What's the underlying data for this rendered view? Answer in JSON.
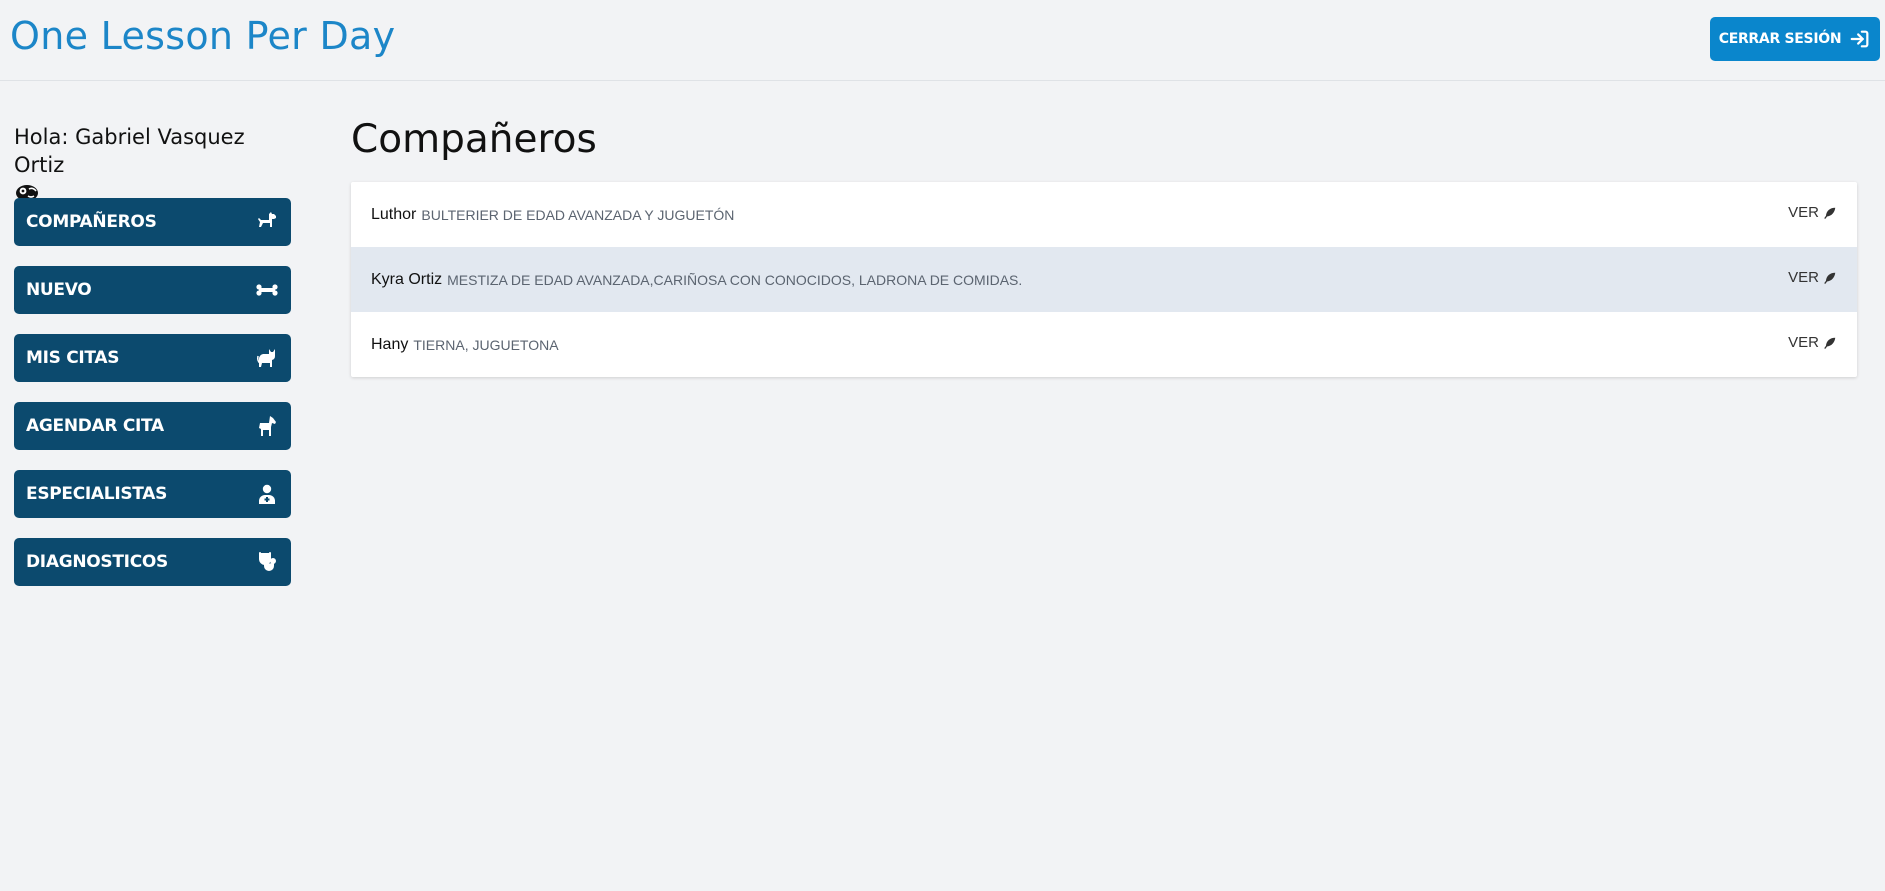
{
  "header": {
    "brand": "One Lesson Per Day",
    "logout_label": "CERRAR SESIÓN",
    "logout_icon": "sign-in-arrow-icon"
  },
  "sidebar": {
    "greeting": "Hola: Gabriel Vasquez Ortiz",
    "greeting_icon": "otter-icon",
    "items": [
      {
        "label": "COMPAÑEROS",
        "icon": "dog-icon"
      },
      {
        "label": "NUEVO",
        "icon": "bone-icon"
      },
      {
        "label": "MIS CITAS",
        "icon": "cat-icon"
      },
      {
        "label": "AGENDAR CITA",
        "icon": "horse-icon"
      },
      {
        "label": "ESPECIALISTAS",
        "icon": "user-doctor-icon"
      },
      {
        "label": "DIAGNOSTICOS",
        "icon": "stethoscope-icon"
      }
    ]
  },
  "main": {
    "title": "Compañeros",
    "rows": [
      {
        "name": "Luthor",
        "description": "BULTERIER DE EDAD AVANZADA Y JUGUETÓN",
        "action": "VER"
      },
      {
        "name": "Kyra Ortiz",
        "description": "MESTIZA DE EDAD AVANZADA,CARIÑOSA CON CONOCIDOS, LADRONA DE COMIDAS.",
        "action": "VER"
      },
      {
        "name": "Hany",
        "description": "TIERNA, JUGUETONA",
        "action": "VER"
      }
    ]
  },
  "colors": {
    "brand": "#1c86c8",
    "nav_bg": "#0c4a6e",
    "logout_bg": "#0a86cc",
    "row_alt_bg": "#e2e8f0"
  }
}
